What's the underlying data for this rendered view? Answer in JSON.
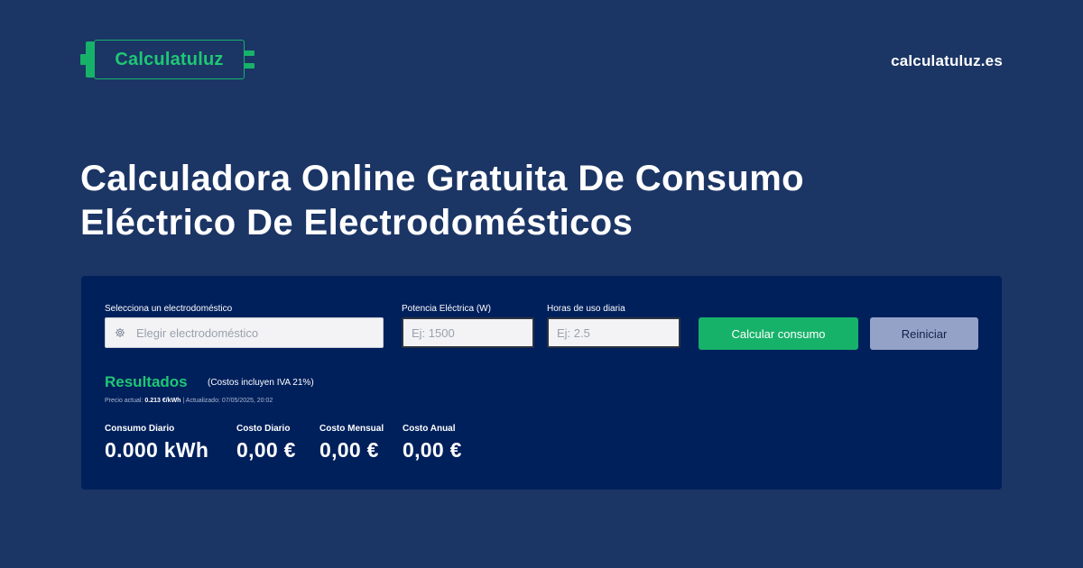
{
  "header": {
    "logo_text": "Calculatuluz",
    "site_url": "calculatuluz.es"
  },
  "title_line1": "Calculadora Online Gratuita De Consumo",
  "title_line2": "Eléctrico De Electrodomésticos",
  "form": {
    "appliance_label": "Selecciona un electrodoméstico",
    "appliance_placeholder": "Elegir electrodoméstico",
    "power_label": "Potencia Eléctrica (W)",
    "power_placeholder": "Ej: 1500",
    "hours_label": "Horas de uso diaria",
    "hours_placeholder": "Ej: 2.5",
    "calculate_button": "Calcular consumo",
    "reset_button": "Reiniciar"
  },
  "results": {
    "title": "Resultados",
    "note": "(Costos incluyen IVA 21%)",
    "price_prefix": "Precio actual:",
    "price_value": "0.213 €/kWh",
    "price_updated": "| Actualizado: 07/05/2025, 20:02",
    "stats": [
      {
        "label": "Consumo Diario",
        "value": "0.000 kWh"
      },
      {
        "label": "Costo Diario",
        "value": "0,00 €"
      },
      {
        "label": "Costo Mensual",
        "value": "0,00 €"
      },
      {
        "label": "Costo Anual",
        "value": "0,00 €"
      }
    ]
  },
  "colors": {
    "page_bg": "#1b3565",
    "panel_bg": "#00205c",
    "accent_green": "#17b26a",
    "reset_button_bg": "#95a2c8"
  },
  "icons": {
    "appliance_select": "gear-icon"
  }
}
